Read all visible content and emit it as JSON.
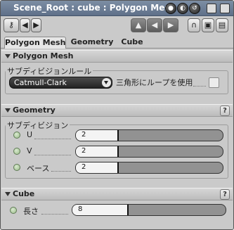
{
  "window": {
    "title": "Scene_Root : cube : Polygon Mesh"
  },
  "tabs": [
    {
      "label": "Polygon Mesh",
      "active": true
    },
    {
      "label": "Geometry",
      "active": false
    },
    {
      "label": "Cube",
      "active": false
    }
  ],
  "polygon_mesh": {
    "header": "Polygon Mesh",
    "group_title": "サブディビジョンルール",
    "dropdown_value": "Catmull-Clark",
    "checkbox_label": "三角形にループを使用",
    "checkbox_checked": false
  },
  "geometry": {
    "header": "Geometry",
    "group_title": "サブディビジョン",
    "params": [
      {
        "label": "U",
        "value": "2",
        "fraction": 0.28
      },
      {
        "label": "V",
        "value": "2",
        "fraction": 0.28
      },
      {
        "label": "ベース",
        "value": "2",
        "fraction": 0.28
      }
    ]
  },
  "cube": {
    "header": "Cube",
    "params": [
      {
        "label": "長さ",
        "value": "8",
        "fraction": 0.36
      }
    ]
  },
  "help_label": "?",
  "colors": {
    "titlebar": "#6b7c95",
    "panel": "#cacaca",
    "led": "#b3cfa5"
  }
}
